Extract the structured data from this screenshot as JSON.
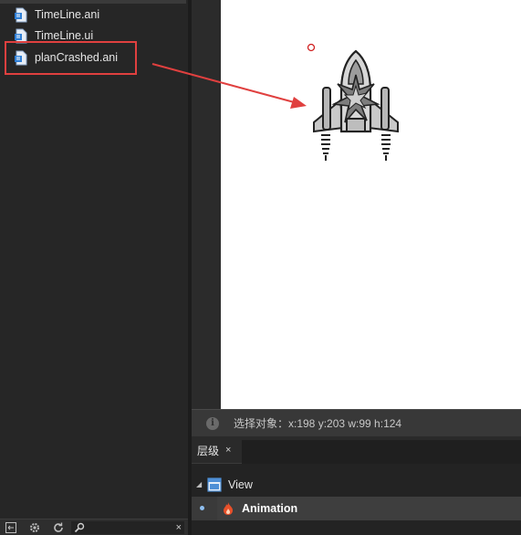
{
  "files": [
    {
      "name": "TimeLine.ani",
      "icon": "file-document-icon"
    },
    {
      "name": "TimeLine.ui",
      "icon": "file-document-icon"
    },
    {
      "name": "planCrashed.ani",
      "icon": "file-document-icon"
    }
  ],
  "highlight_color": "#e0403f",
  "status": {
    "text": "选择对象：x:198 y:203  w:99 h:124"
  },
  "layers": {
    "tab_label": "层级",
    "tab_close": "×",
    "nodes": [
      {
        "label": "View",
        "icon": "view-icon"
      },
      {
        "label": "Animation",
        "icon": "flame-icon"
      }
    ]
  },
  "toolbar": {
    "search_close": "×"
  },
  "annotation": {
    "arrow_color": "#e0403f"
  }
}
